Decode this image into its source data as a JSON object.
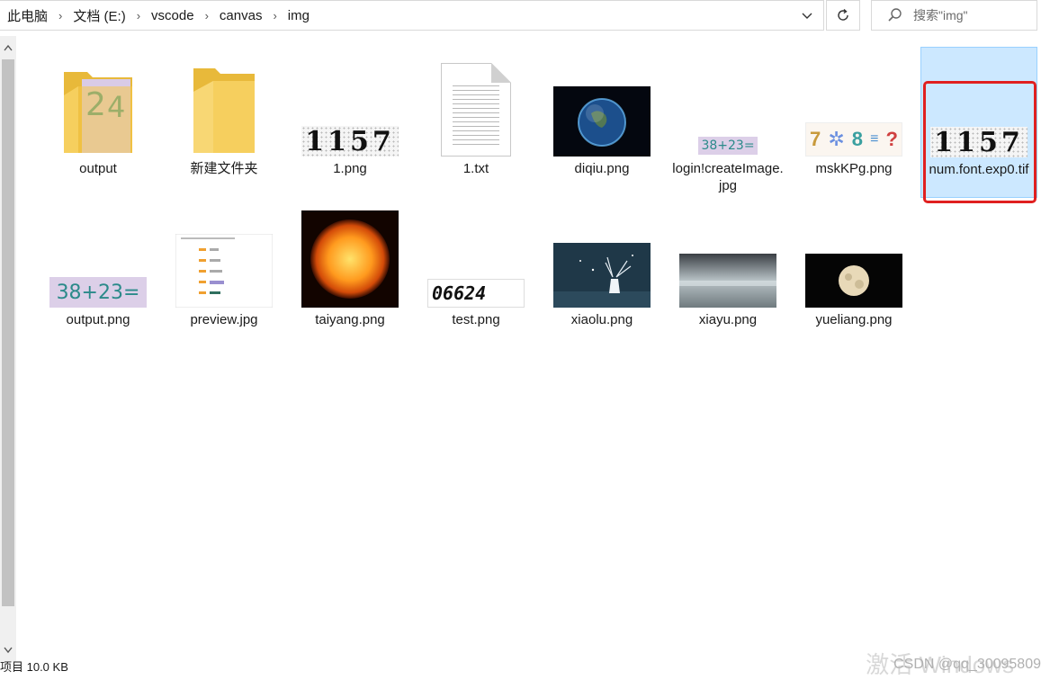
{
  "breadcrumb": [
    "此电脑",
    "文档 (E:)",
    "vscode",
    "canvas",
    "img"
  ],
  "search": {
    "placeholder": "搜索\"img\""
  },
  "files": [
    {
      "name": "output",
      "kind": "folder-with-preview"
    },
    {
      "name": "新建文件夹",
      "kind": "folder"
    },
    {
      "name": "1.png",
      "kind": "captcha",
      "text": "1157"
    },
    {
      "name": "1.txt",
      "kind": "text-document"
    },
    {
      "name": "diqiu.png",
      "kind": "earth-photo"
    },
    {
      "name": "login!createImage.jpg",
      "kind": "math-captcha",
      "text": "38+23="
    },
    {
      "name": "mskKPg.png",
      "kind": "symbol-captcha",
      "text": "7⌘8≡?"
    },
    {
      "name": "num.font.exp0.tif",
      "kind": "captcha",
      "text": "1157",
      "selected": true
    },
    {
      "name": "output.png",
      "kind": "math-captcha",
      "text": "38+23="
    },
    {
      "name": "preview.jpg",
      "kind": "screenshot-preview"
    },
    {
      "name": "taiyang.png",
      "kind": "sun-photo"
    },
    {
      "name": "test.png",
      "kind": "digits",
      "text": "06624"
    },
    {
      "name": "xiaolu.png",
      "kind": "deer-photo"
    },
    {
      "name": "xiayu.png",
      "kind": "rain-photo"
    },
    {
      "name": "yueliang.png",
      "kind": "moon-photo"
    }
  ],
  "status": {
    "text": "项目  10.0 KB"
  },
  "watermark": {
    "text": "CSDN @qq_30095809",
    "activation": "激活 Windows"
  },
  "colors": {
    "selection": "#cce8ff",
    "highlight": "#e02020",
    "folder": "#f5c84b"
  }
}
